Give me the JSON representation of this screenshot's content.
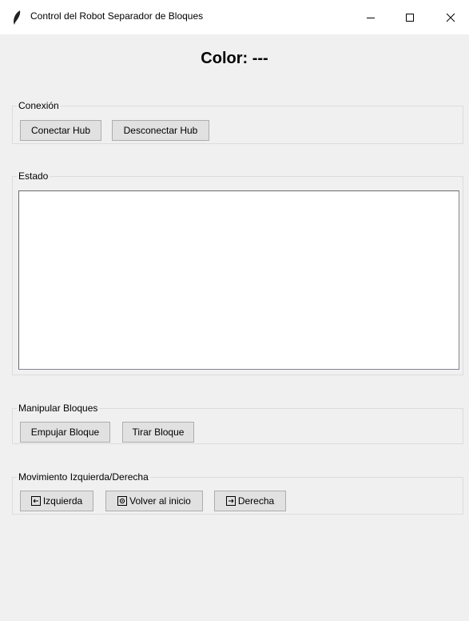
{
  "window": {
    "title": "Control del Robot Separador de Bloques",
    "controls": {
      "minimize_icon": "minimize-icon",
      "maximize_icon": "maximize-icon",
      "close_icon": "close-icon"
    }
  },
  "color_display": {
    "text": "Color: ---"
  },
  "connection": {
    "label": "Conexión",
    "connect_button": "Conectar Hub",
    "disconnect_button": "Desconectar Hub"
  },
  "status": {
    "label": "Estado",
    "log_text": ""
  },
  "manipulate": {
    "label": "Manipular Bloques",
    "push_button": "Empujar Bloque",
    "pull_button": "Tirar Bloque"
  },
  "movement": {
    "label": "Movimiento Izquierda/Derecha",
    "left_button": "Izquierda",
    "home_button": "Volver al inicio",
    "right_button": "Derecha",
    "left_icon": "arrow-left-icon",
    "home_icon": "home-icon",
    "right_icon": "arrow-right-icon"
  }
}
